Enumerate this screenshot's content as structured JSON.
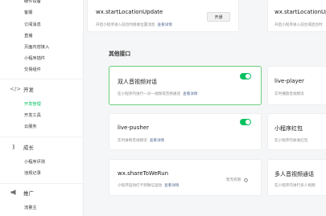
{
  "sidebar": {
    "items_top": [
      {
        "label": "硬件设备"
      },
      {
        "label": "客服"
      },
      {
        "label": "订阅消息"
      },
      {
        "label": "直播"
      },
      {
        "label": "页面内容接入"
      },
      {
        "label": "小程序插件"
      },
      {
        "label": "交易组件"
      }
    ],
    "sections": [
      {
        "label": "开发",
        "icon": "code-icon",
        "items": [
          {
            "label": "开发管理"
          },
          {
            "label": "开发工具"
          },
          {
            "label": "云服务"
          }
        ]
      },
      {
        "label": "成长",
        "icon": "growth-icon",
        "items": [
          {
            "label": "小程序评测"
          },
          {
            "label": "违规记录"
          }
        ]
      },
      {
        "label": "推广",
        "icon": "megaphone-icon",
        "items": [
          {
            "label": "流量主"
          }
        ]
      }
    ]
  },
  "main": {
    "top_cards": [
      {
        "title": "wx.startLocationUpdate",
        "desc": "开启小程序进入前台时接收位置消息",
        "link": "查看详情",
        "button": "开通"
      },
      {
        "title": "wx.startLocationUp",
        "desc": "开启小程序进入前台或后台时"
      }
    ],
    "section_title": "其他接口",
    "cards": [
      {
        "title": "双人音视频对话",
        "desc": "在小程序内进行一对一视频或音频通话",
        "link": "查看详情",
        "toggle": true
      },
      {
        "title": "live-player",
        "desc": "实时播放音视频流"
      },
      {
        "title": "live-pusher",
        "desc": "实时录制音视频流",
        "link": "查看详情",
        "toggle": true
      },
      {
        "title": "小程序红包",
        "desc": "在小程序内收发红包"
      },
      {
        "title": "wx.shareToWeRun",
        "desc": "小程序运动打卡到微信运动",
        "link": "查看详情",
        "perm": "暂无权限"
      },
      {
        "title": "多人音视频通话",
        "desc": "在小程序内进行多人视频"
      }
    ]
  },
  "colors": {
    "accent": "#07c160",
    "link": "#576b95",
    "active_border": "#6ccf7b"
  }
}
